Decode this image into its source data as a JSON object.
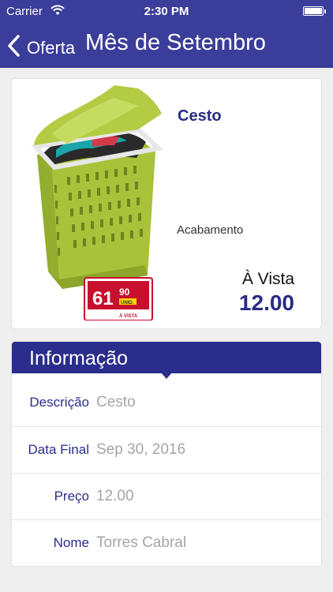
{
  "status_bar": {
    "carrier": "Carrier",
    "time": "2:30 PM"
  },
  "nav": {
    "back_label": "Oferta",
    "title": "Mês de Setembro"
  },
  "product": {
    "name": "Cesto",
    "finish": "Acabamento",
    "price_label": "À Vista",
    "price_value": "12.00",
    "tag_price_main": "61",
    "tag_price_cents": "90",
    "tag_unit": "UNID.",
    "tag_note": "À VISTA"
  },
  "info": {
    "header": "Informação",
    "rows": [
      {
        "label": "Descrição",
        "value": "Cesto"
      },
      {
        "label": "Data Final",
        "value": "Sep 30, 2016"
      },
      {
        "label": "Preço",
        "value": "12.00"
      },
      {
        "label": "Nome",
        "value": "Torres Cabral"
      }
    ]
  },
  "colors": {
    "nav_background": "#3b3d9a",
    "accent": "#2b2d8c",
    "basket_green": "#a8c23a",
    "tag_red": "#c8102e"
  }
}
